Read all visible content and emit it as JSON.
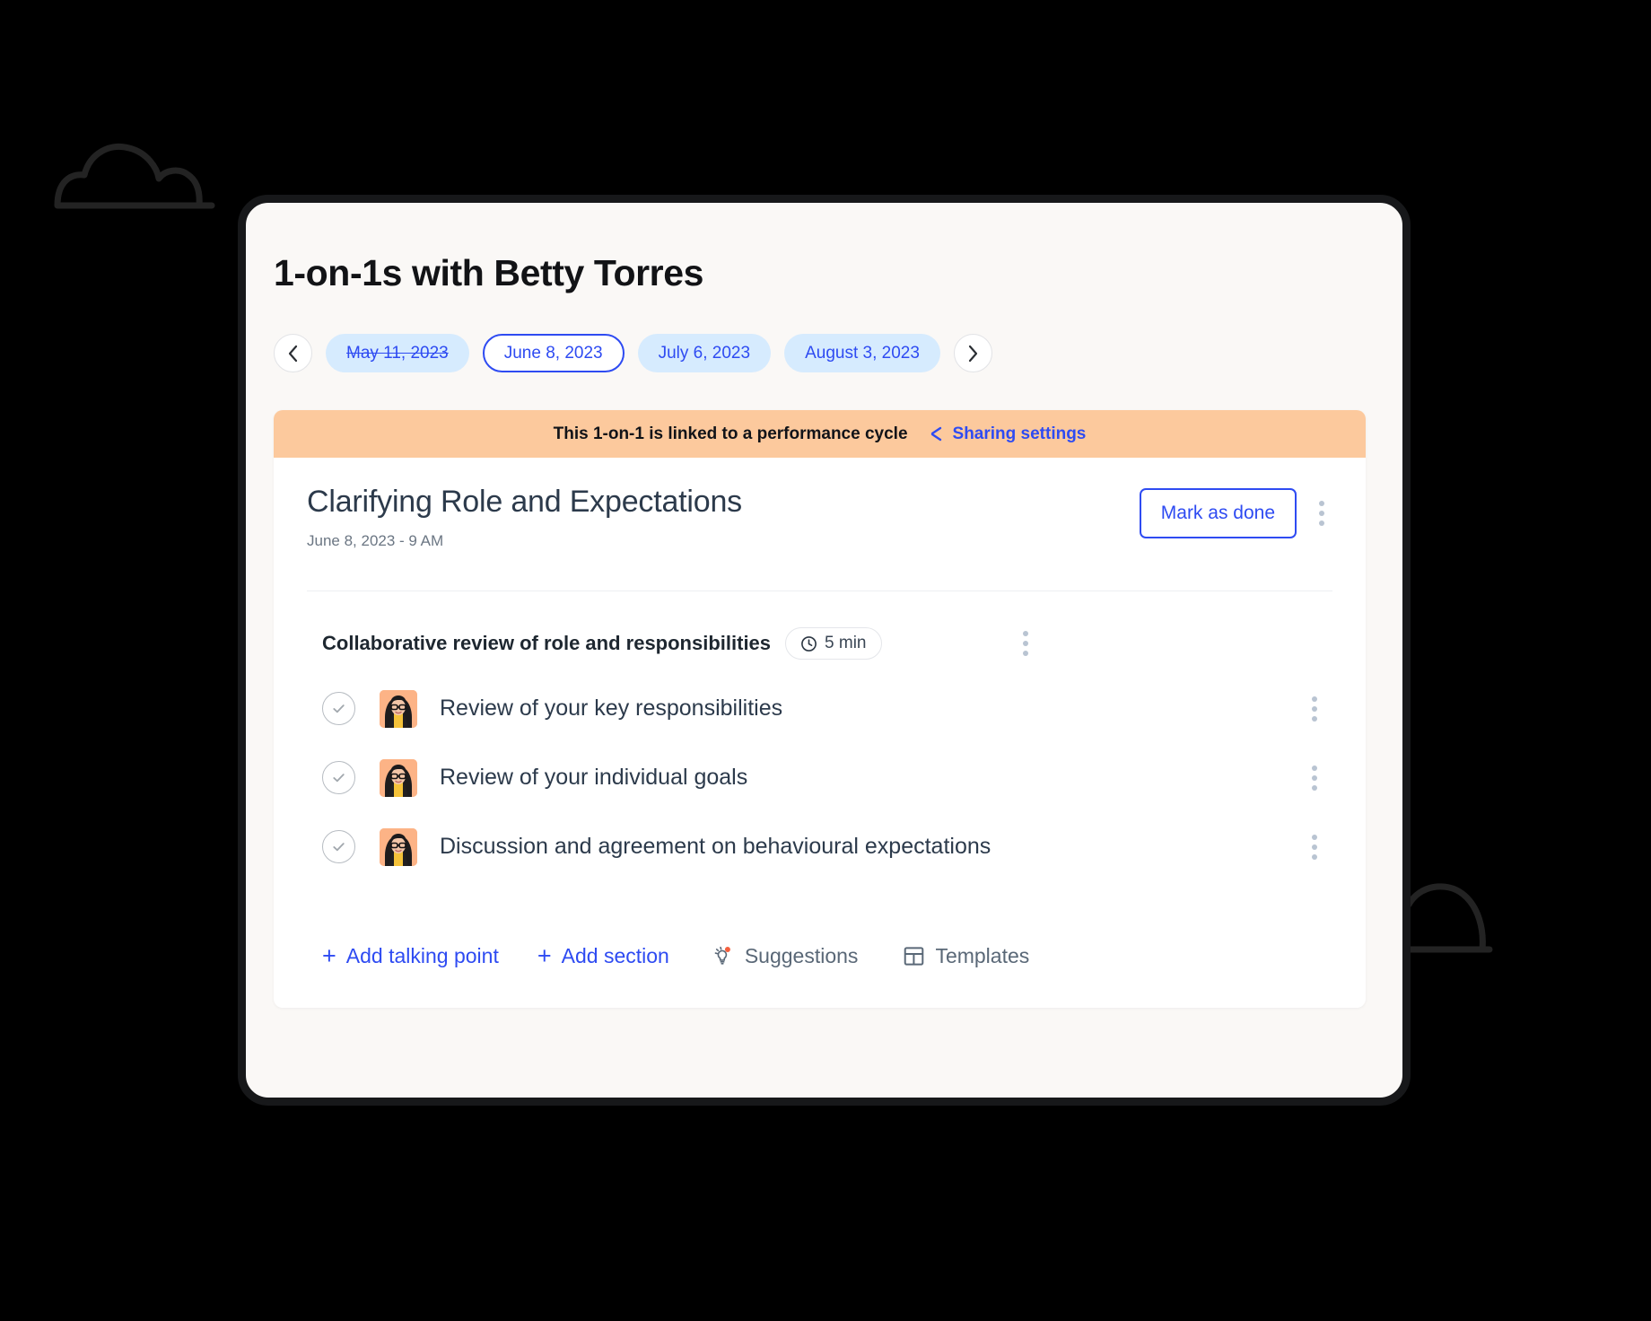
{
  "page": {
    "title": "1-on-1s with Betty Torres",
    "background_color": "#000000",
    "card_background": "#FAF8F6"
  },
  "decorations": {
    "cloud_top_left": "cloud-icon",
    "cloud_bottom_right": "cloud-icon"
  },
  "date_nav": {
    "prev_label": "chevron-left-icon",
    "next_label": "chevron-right-icon",
    "pills": [
      {
        "label": "May 11, 2023",
        "state": "past",
        "strikethrough": true,
        "selected": false
      },
      {
        "label": "June 8, 2023",
        "state": "current",
        "strikethrough": false,
        "selected": true
      },
      {
        "label": "July 6, 2023",
        "state": "upcoming",
        "strikethrough": false,
        "selected": false
      },
      {
        "label": "August 3, 2023",
        "state": "upcoming",
        "strikethrough": false,
        "selected": false
      }
    ]
  },
  "banner": {
    "text": "This 1-on-1 is linked to a performance cycle",
    "link_label": "Sharing settings",
    "link_icon": "share-icon",
    "background_color": "#FCC99D",
    "link_color": "#2E4BF2"
  },
  "meeting": {
    "title": "Clarifying Role and Expectations",
    "subtitle": "June 8, 2023 - 9 AM",
    "mark_done_label": "Mark as done",
    "menu_icon": "kebab-menu-icon"
  },
  "section": {
    "title": "Collaborative review of role and responsibilities",
    "duration_label": "5 min",
    "duration_icon": "clock-icon",
    "menu_icon": "kebab-menu-icon"
  },
  "talking_points": [
    {
      "text": "Review of your key responsibilities",
      "checked": false,
      "avatar": "avatar-betty-torres",
      "menu_icon": "kebab-menu-icon"
    },
    {
      "text": "Review of your individual goals",
      "checked": false,
      "avatar": "avatar-betty-torres",
      "menu_icon": "kebab-menu-icon"
    },
    {
      "text": "Discussion and agreement on behavioural expectations",
      "checked": false,
      "avatar": "avatar-betty-torres",
      "menu_icon": "kebab-menu-icon"
    }
  ],
  "actions": [
    {
      "label": "Add talking point",
      "icon": "plus-icon",
      "style": "blue"
    },
    {
      "label": "Add section",
      "icon": "plus-icon",
      "style": "blue"
    },
    {
      "label": "Suggestions",
      "icon": "lightbulb-icon",
      "style": "gray"
    },
    {
      "label": "Templates",
      "icon": "layout-icon",
      "style": "gray"
    }
  ],
  "colors": {
    "accent_blue": "#2E4BF2",
    "pill_blue_bg": "#D6EBFE",
    "banner_peach": "#FCC99D",
    "text_dark": "#2C3A4B",
    "muted": "#6B7683"
  }
}
